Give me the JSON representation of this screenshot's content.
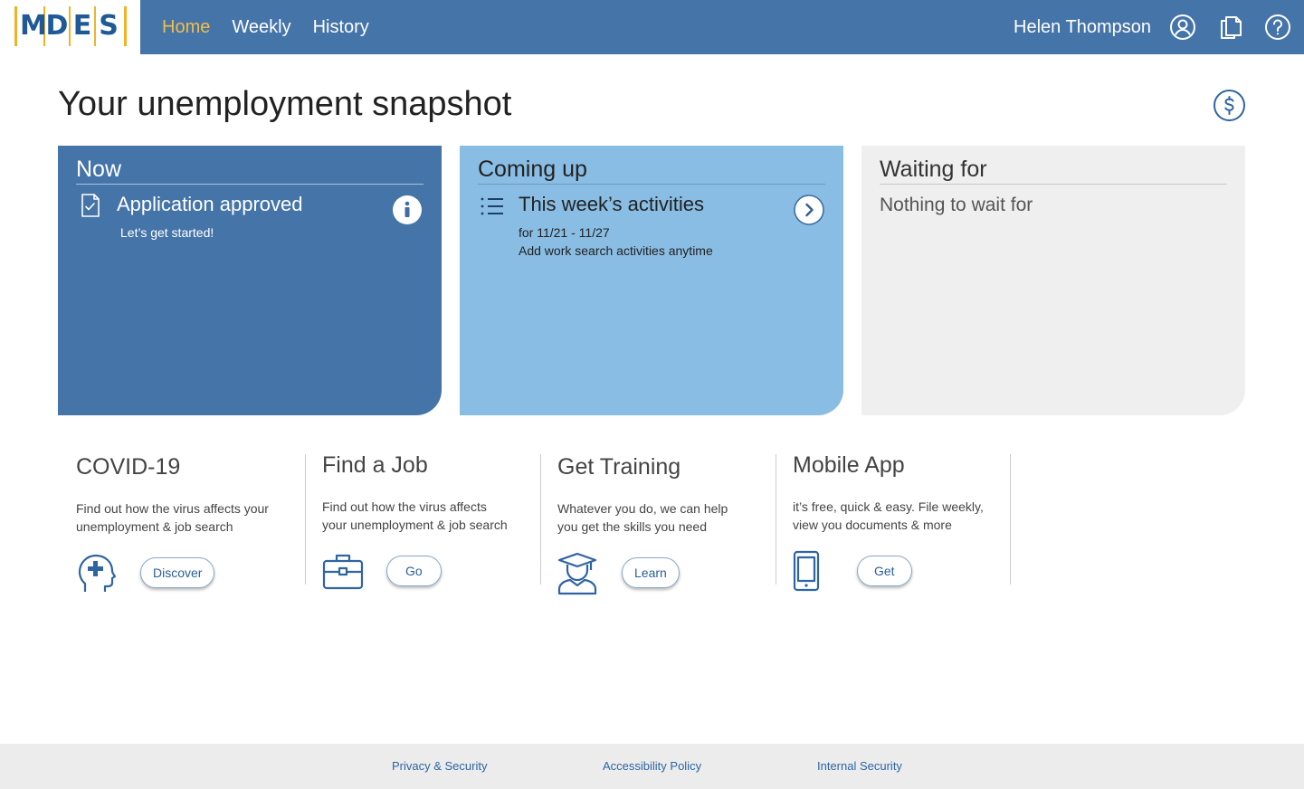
{
  "brand": {
    "logo_letters": [
      "M",
      "D",
      "E",
      "S"
    ]
  },
  "nav": {
    "items": [
      {
        "label": "Home",
        "active": true
      },
      {
        "label": "Weekly",
        "active": false
      },
      {
        "label": "History",
        "active": false
      }
    ]
  },
  "header": {
    "user_name": "Helen Thompson",
    "icons": [
      "user-icon",
      "documents-icon",
      "help-icon"
    ]
  },
  "main": {
    "title": "Your unemployment snapshot",
    "payments_icon": "dollar-icon"
  },
  "cards": {
    "now": {
      "heading": "Now",
      "item_title": "Application approved",
      "item_sub": "Let’s get started!",
      "icon": "document-check-icon",
      "action_icon": "info-icon"
    },
    "coming_up": {
      "heading": "Coming up",
      "item_title": "This week’s activities",
      "item_dates": "for 11/21 - 11/27",
      "item_note": "Add work search activities anytime",
      "icon": "list-icon",
      "action_icon": "chevron-right-icon"
    },
    "waiting": {
      "heading": "Waiting for",
      "text": "Nothing to wait for"
    }
  },
  "tiles": [
    {
      "title": "COVID-19",
      "desc": [
        "Find out how the virus affects your",
        "unemployment & job search"
      ],
      "button": "Discover",
      "icon": "head-medical-icon"
    },
    {
      "title": "Find a Job",
      "desc": [
        "Find out how the virus affects",
        "your unemployment & job search"
      ],
      "button": "Go",
      "icon": "briefcase-icon"
    },
    {
      "title": "Get Training",
      "desc": [
        "Whatever you do, we can help",
        "you get the skills you need"
      ],
      "button": "Learn",
      "icon": "graduate-icon"
    },
    {
      "title": "Mobile App",
      "desc": [
        "it’s free, quick & easy. File weekly,",
        "view you documents & more"
      ],
      "button": "Get",
      "icon": "phone-icon"
    }
  ],
  "footer": {
    "links": [
      "Privacy & Security",
      "Accessibility Policy",
      "Internal Security"
    ]
  },
  "colors": {
    "header_bg": "#4574a9",
    "nav_active": "#f3bd48",
    "card_now": "#4574a9",
    "card_coming_up": "#89bde3",
    "card_waiting": "#efefef",
    "link": "#2d65a5"
  }
}
